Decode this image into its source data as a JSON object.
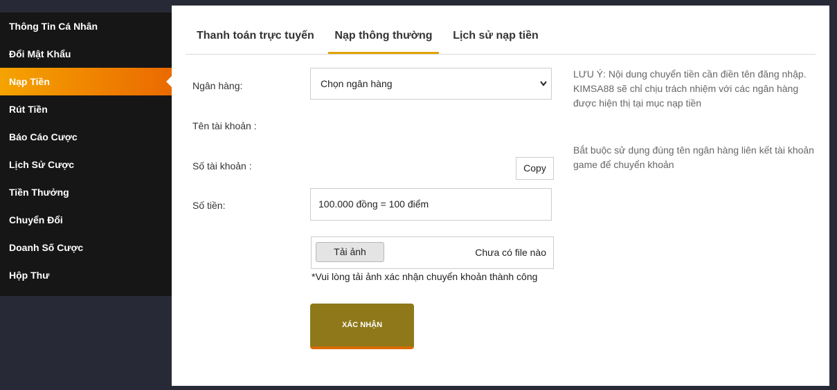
{
  "sidebar": {
    "items": [
      {
        "label": "Thông Tin Cá Nhân"
      },
      {
        "label": "Đổi Mật Khẩu"
      },
      {
        "label": "Nạp Tiền"
      },
      {
        "label": "Rút Tiền"
      },
      {
        "label": "Báo Cáo Cược"
      },
      {
        "label": "Lịch Sử Cược"
      },
      {
        "label": "Tiền Thưởng"
      },
      {
        "label": "Chuyển Đổi"
      },
      {
        "label": "Doanh Số Cược"
      },
      {
        "label": "Hộp Thư"
      }
    ],
    "active_index": 2,
    "active_color": "#f29000"
  },
  "tabs": [
    {
      "label": "Thanh toán trực tuyến"
    },
    {
      "label": "Nạp thông thường"
    },
    {
      "label": "Lịch sử nạp tiền"
    }
  ],
  "form": {
    "bank_label": "Ngân hàng:",
    "bank_select_value": "Chọn ngân hàng",
    "account_name_label": "Tên tài khoản :",
    "account_number_label": "Số tài khoản :",
    "copy_label": "Copy",
    "amount_label": "Số tiền:",
    "amount_value": "100.000 đồng = 100 điểm",
    "upload_button": "Tải ảnh",
    "upload_status": "Chưa có file nào",
    "upload_hint": "*Vui lòng tải ảnh xác nhận chuyển khoản thành công",
    "submit_label": "XÁC NHẬN"
  },
  "notes": {
    "note1": "LƯU Ý: Nội dung chuyển tiền cần điền tên đăng nhập. KIMSA88 sẽ chỉ chịu trách nhiệm với các ngân hàng được hiện thị tại mục nạp tiền",
    "note2": "Bắt buộc sử dụng đúng tên ngân hàng liên kết tài khoản game để chuyển khoản"
  },
  "colors": {
    "accent": "#e2a100",
    "submit_bg": "#8e781a"
  }
}
